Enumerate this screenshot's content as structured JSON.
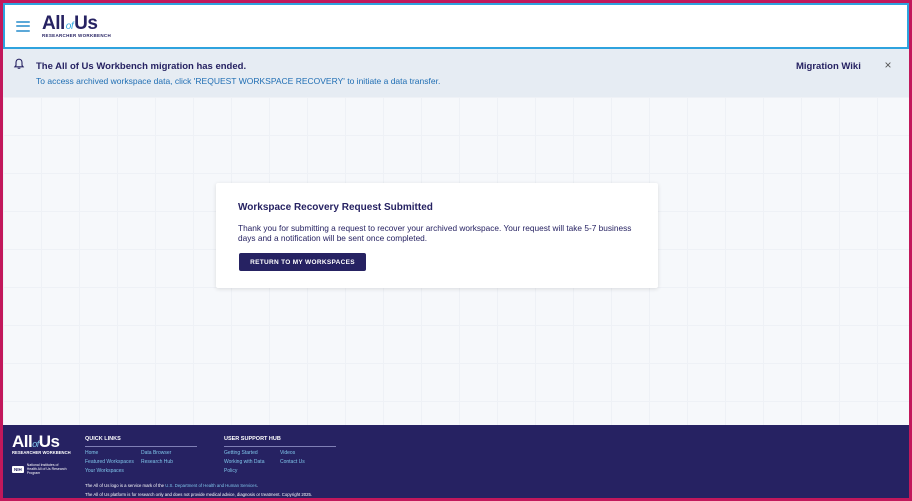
{
  "header": {
    "logo_main_1": "All",
    "logo_of": "of",
    "logo_main_2": "Us",
    "logo_sub": "RESEARCHER WORKBENCH"
  },
  "banner": {
    "title": "The All of Us Workbench migration has ended.",
    "message": "To access archived workspace data, click 'REQUEST WORKSPACE RECOVERY' to initiate a data transfer.",
    "wiki_link": "Migration Wiki",
    "close": "×"
  },
  "card": {
    "title": "Workspace Recovery Request Submitted",
    "text": "Thank you for submitting a request to recover your archived workspace. Your request will take 5-7 business days and a notification will be sent once completed.",
    "button": "RETURN TO MY WORKSPACES"
  },
  "footer": {
    "logo_main_1": "All",
    "logo_of": "of",
    "logo_main_2": "Us",
    "logo_sub": "RESEARCHER WORKBENCH",
    "nih_badge": "NIH",
    "nih_text": "National Institutes of Health All of Us Research Program",
    "quick_links": {
      "heading": "QUICK LINKS",
      "items": [
        "Home",
        "Data Browser",
        "Featured Workspaces",
        "Research Hub",
        "Your Workspaces"
      ]
    },
    "support_hub": {
      "heading": "USER SUPPORT HUB",
      "items": [
        "Getting Started",
        "Videos",
        "Working with Data",
        "Contact Us",
        "Policy"
      ]
    },
    "note1_pre": "The All of Us logo is a service mark of the ",
    "note1_link": "U.S. Department of Health and Human Services",
    "note1_post": ".",
    "note2": "The All of Us platform is for research only and does not provide medical advice, diagnosis or treatment. Copyright 2025."
  },
  "colors": {
    "navy": "#262262",
    "accent_blue": "#2ea3de",
    "link_blue": "#216fb4",
    "frame_magenta": "#c2185b"
  },
  "icons": {
    "menu": "hamburger-menu-icon",
    "bell": "bell-icon",
    "close": "close-icon"
  }
}
